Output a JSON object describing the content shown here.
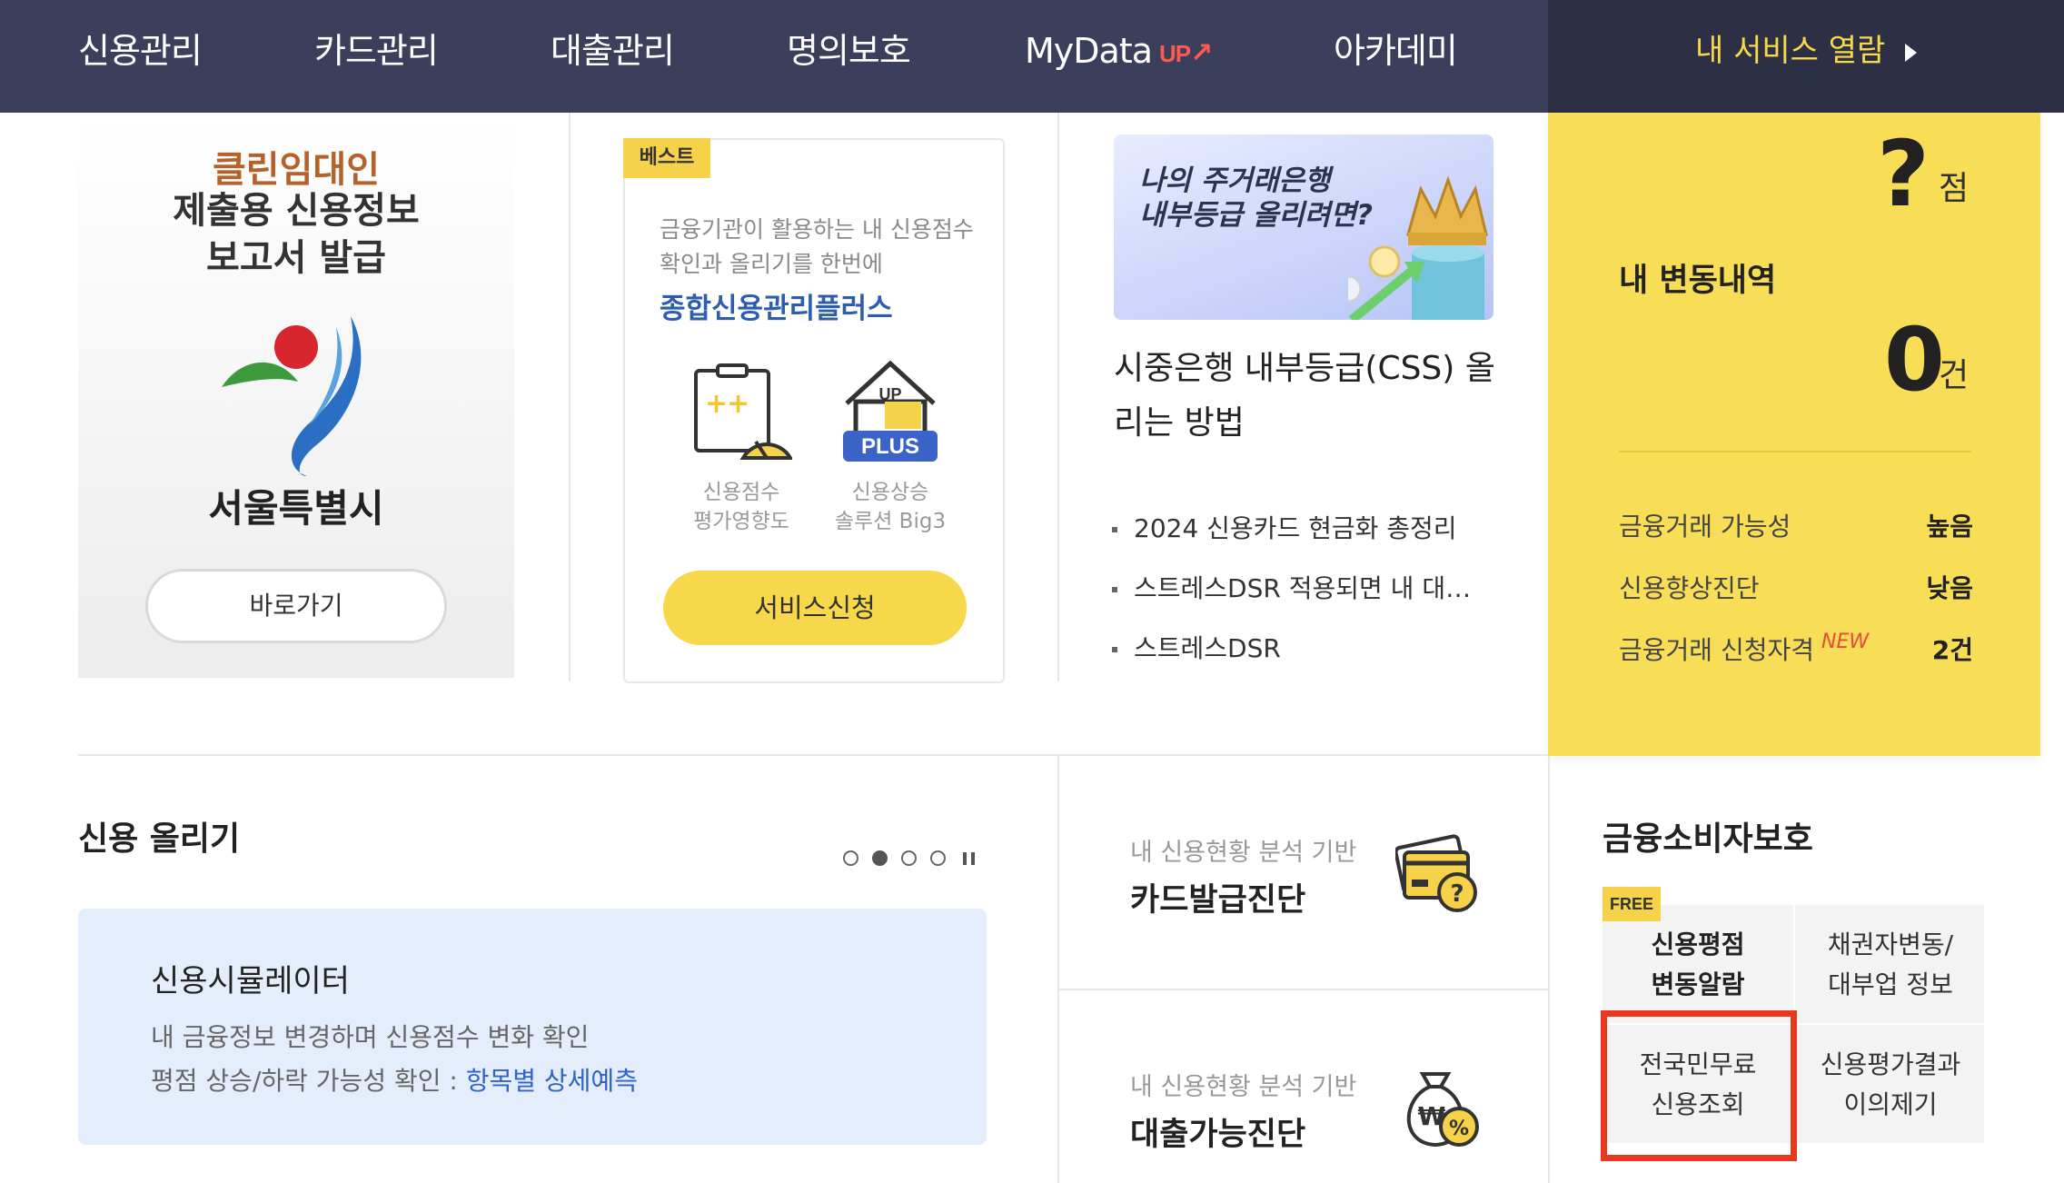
{
  "nav": {
    "items": [
      "신용관리",
      "카드관리",
      "대출관리",
      "명의보호",
      "MyData",
      "아카데미"
    ],
    "mydata_badge": "UP",
    "my_services": "내 서비스 열람"
  },
  "clean_rental": {
    "title_line1": "클린임대인",
    "title_line2": "제출용 신용정보",
    "title_line3": "보고서 발급",
    "org_name": "서울특별시",
    "button": "바로가기"
  },
  "best_card": {
    "tag": "베스트",
    "desc_line1": "금융기관이 활용하는 내 신용점수",
    "desc_line2": "확인과 올리기를 한번에",
    "product": "종합신용관리플러스",
    "icon1_line1": "신용점수",
    "icon1_line2": "평가영향도",
    "icon2_badge_top": "UP",
    "icon2_badge": "PLUS",
    "icon2_line1": "신용상승",
    "icon2_line2": "솔루션 Big3",
    "button": "서비스신청"
  },
  "article": {
    "banner_line1": "나의 주거래은행",
    "banner_line2": "내부등급 올리려면?",
    "title": "시중은행 내부등급(CSS) 올리는 방법",
    "news": [
      "2024 신용카드 현금화 총정리",
      "스트레스DSR 적용되면 내 대출한도는?",
      "스트레스DSR"
    ]
  },
  "score_panel": {
    "score": "?",
    "score_unit": "점",
    "changes_title": "내 변동내역",
    "changes_count": "0",
    "changes_unit": "건",
    "rows": [
      {
        "label": "금융거래 가능성",
        "value": "높음",
        "new": ""
      },
      {
        "label": "신용향상진단",
        "value": "낮음",
        "new": ""
      },
      {
        "label": "금융거래 신청자격",
        "value": "2건",
        "new": "NEW"
      }
    ]
  },
  "credit_up": {
    "title": "신용 올리기",
    "card_title": "신용시뮬레이터",
    "desc1": "내 금융정보 변경하며 신용점수 변화 확인",
    "desc2_prefix": "평점 상승/하락 가능성 확인 : ",
    "desc2_link": "항목별 상세예측"
  },
  "diagnosis": [
    {
      "subtitle": "내 신용현황 분석 기반",
      "title": "카드발급진단",
      "icon": "card-question-icon"
    },
    {
      "subtitle": "내 신용현황 분석 기반",
      "title": "대출가능진단",
      "icon": "money-bag-percent-icon"
    }
  ],
  "consumer_protection": {
    "title": "금융소비자보호",
    "free_tag": "FREE",
    "cells": [
      {
        "line1": "신용평점",
        "line2": "변동알람"
      },
      {
        "line1": "채권자변동/",
        "line2": "대부업 정보"
      },
      {
        "line1": "전국민무료",
        "line2": "신용조회"
      },
      {
        "line1": "신용평가결과",
        "line2": "이의제기"
      }
    ]
  },
  "colors": {
    "nav_bg": "#3b3f5c",
    "nav_right_bg": "#2d3045",
    "accent_yellow": "#f8de57",
    "link_blue": "#2e5dad",
    "highlight_red": "#e8391f"
  }
}
